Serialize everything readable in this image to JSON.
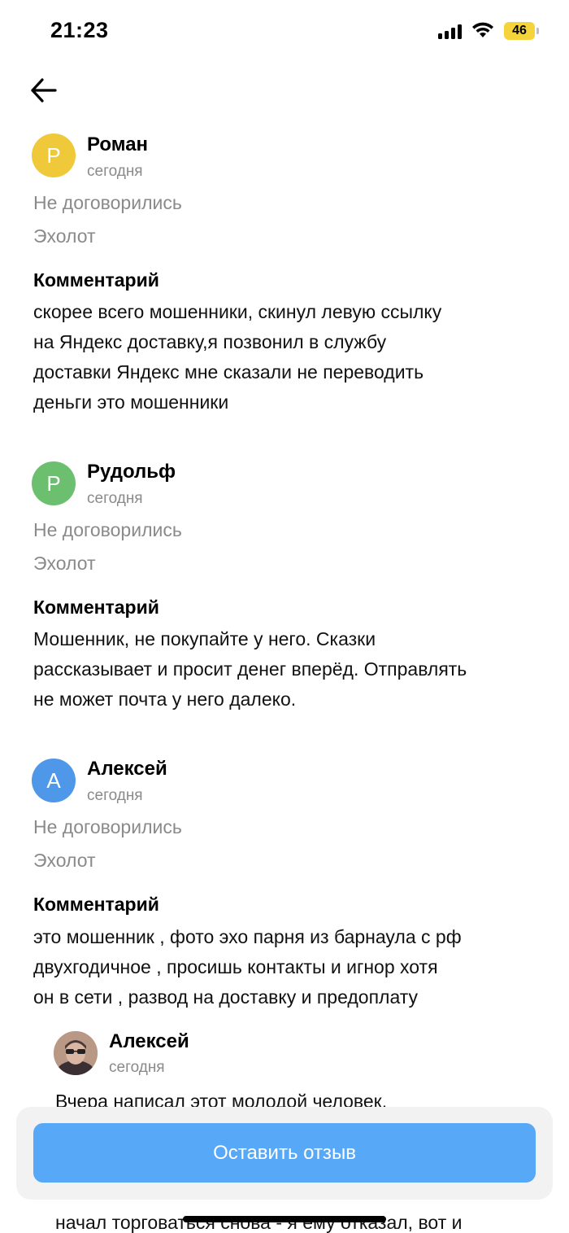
{
  "status_bar": {
    "time": "21:23",
    "battery": "46",
    "battery_color": "#f5d33a",
    "icons": [
      "signal-icon",
      "wifi-icon",
      "battery-icon"
    ]
  },
  "nav": {
    "back_icon": "arrow-left-icon"
  },
  "reviews": [
    {
      "initial": "Р",
      "avatar_color": "#f0c93a",
      "name": "Роман",
      "date": "сегодня",
      "status": "Не договорились",
      "item": "Эхолот",
      "comment_heading": "Комментарий",
      "comment_lines": [
        "скорее всего мошенники, скинул левую ссылку",
        "на Яндекс доставку,я позвонил в службу",
        "доставки Яндекс мне сказали не переводить",
        "деньги это мошенники"
      ]
    },
    {
      "initial": "Р",
      "avatar_color": "#6cbf6e",
      "name": "Рудольф",
      "date": "сегодня",
      "status": "Не договорились",
      "item": "Эхолот",
      "comment_heading": "Комментарий",
      "comment_lines": [
        "Мошенник, не покупайте у него.  Сказки",
        "рассказывает и просит денег вперёд. Отправлять",
        "не может почта у него далеко."
      ]
    },
    {
      "initial": "А",
      "avatar_color": "#4f97e8",
      "name": "Алексей",
      "date": "сегодня",
      "status": "Не договорились",
      "item": "Эхолот",
      "comment_heading": "Комментарий",
      "comment_lines": [
        "это мошенник , фото эхо парня из барнаула с рф",
        "двухгодичное , просишь контакты и игнор хотя",
        "он в сети , развод на доставку и предоплату"
      ]
    }
  ],
  "reply": {
    "name": "Алексей",
    "date": "сегодня",
    "line1": "Вчера написал этот молодой человек,",
    "line2_fragment": "...",
    "line3": "начал торговаться снова - я ему отказал, вот и"
  },
  "action": {
    "leave_review_label": "Оставить отзыв",
    "button_color": "#57a8f7"
  }
}
